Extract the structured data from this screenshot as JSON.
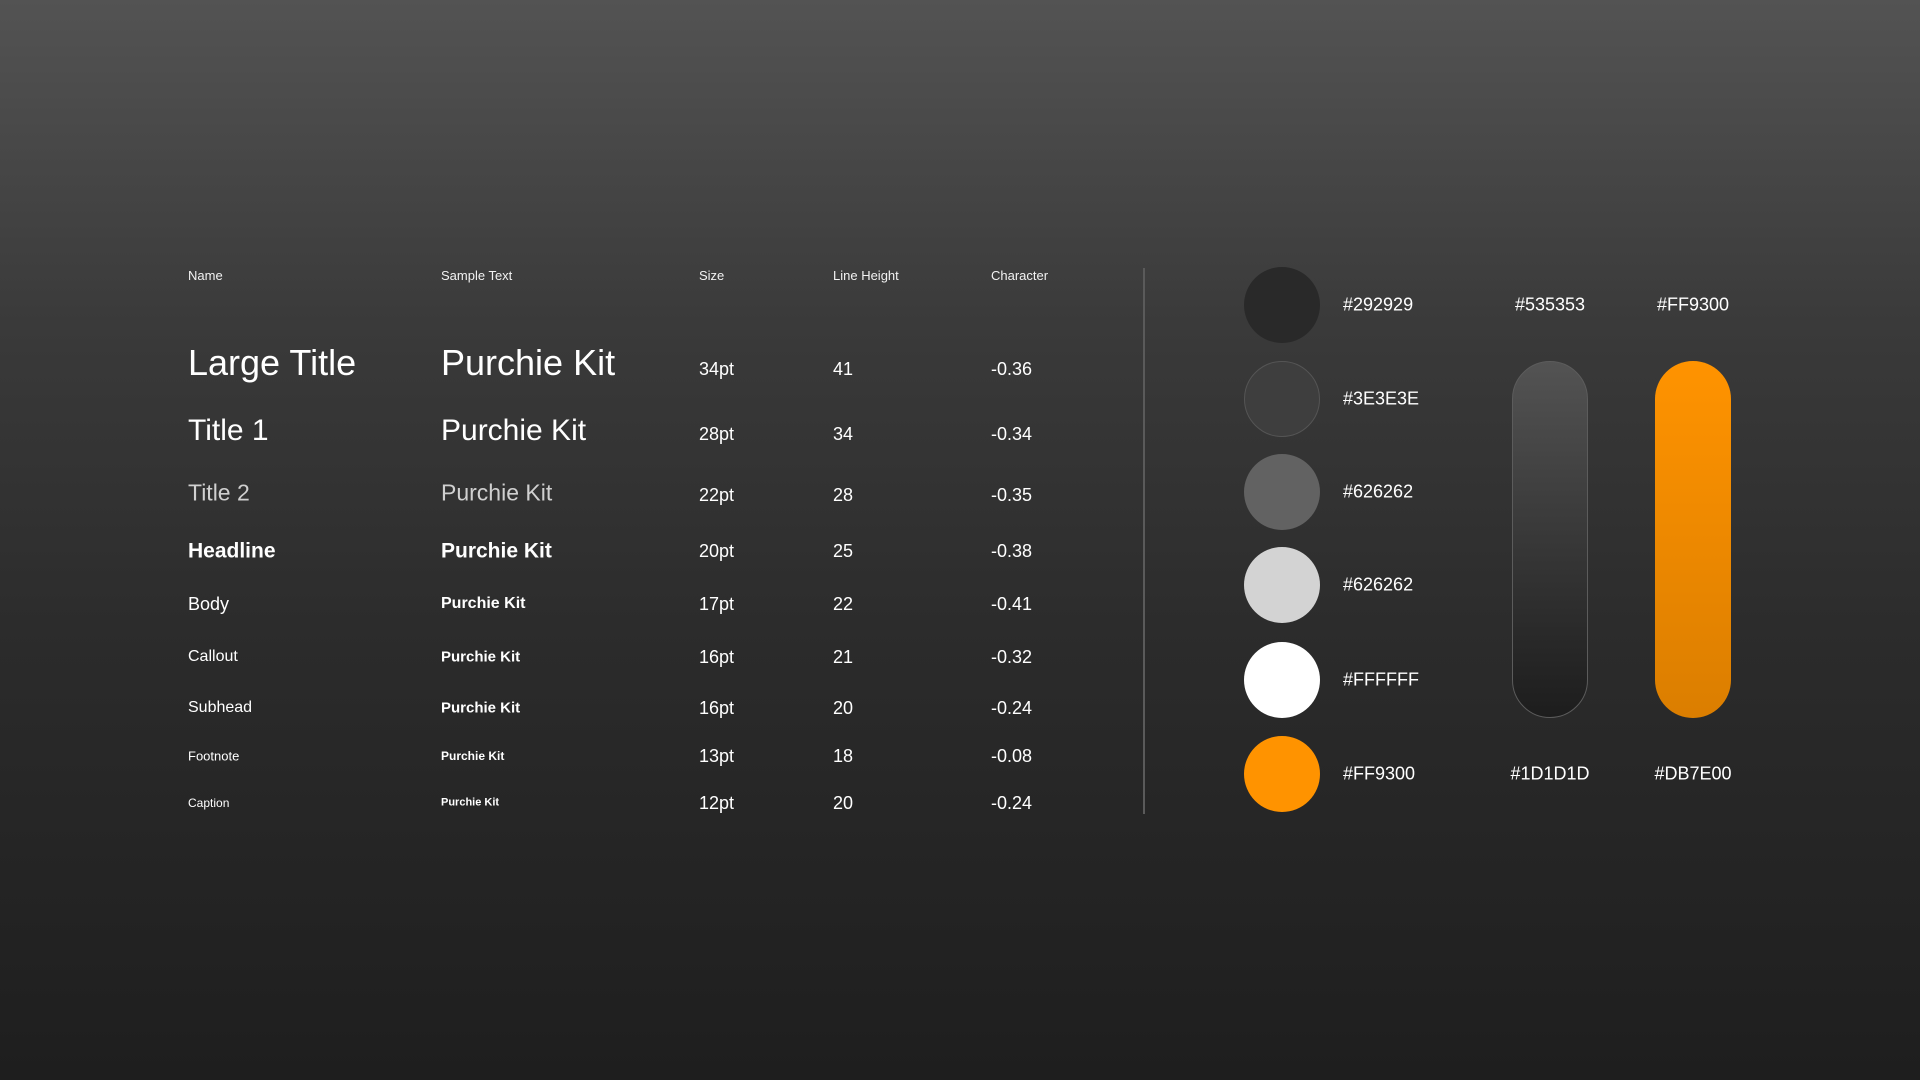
{
  "typography": {
    "headers": {
      "name": "Name",
      "sample": "Sample Text",
      "size": "Size",
      "line_height": "Line Height",
      "character": "Character"
    },
    "rows": [
      {
        "name": "Large Title",
        "sample": "Purchie Kit",
        "size": "34pt",
        "line_height": "41",
        "character": "-0.36"
      },
      {
        "name": "Title 1",
        "sample": "Purchie Kit",
        "size": "28pt",
        "line_height": "34",
        "character": "-0.34"
      },
      {
        "name": "Title 2",
        "sample": "Purchie Kit",
        "size": "22pt",
        "line_height": "28",
        "character": "-0.35"
      },
      {
        "name": "Headline",
        "sample": "Purchie Kit",
        "size": "20pt",
        "line_height": "25",
        "character": "-0.38"
      },
      {
        "name": "Body",
        "sample": "Purchie Kit",
        "size": "17pt",
        "line_height": "22",
        "character": "-0.41"
      },
      {
        "name": "Callout",
        "sample": "Purchie Kit",
        "size": "16pt",
        "line_height": "21",
        "character": "-0.32"
      },
      {
        "name": "Subhead",
        "sample": "Purchie Kit",
        "size": "16pt",
        "line_height": "20",
        "character": "-0.24"
      },
      {
        "name": "Footnote",
        "sample": "Purchie Kit",
        "size": "13pt",
        "line_height": "18",
        "character": "-0.08"
      },
      {
        "name": "Caption",
        "sample": "Purchie Kit",
        "size": "12pt",
        "line_height": "20",
        "character": "-0.24"
      }
    ]
  },
  "palette": {
    "swatches": [
      {
        "label": "#292929",
        "color": "#292929"
      },
      {
        "label": "#3E3E3E",
        "color": "#3E3E3E"
      },
      {
        "label": "#626262",
        "color": "#626262"
      },
      {
        "label": "#626262",
        "color": "#D3D3D3"
      },
      {
        "label": "#FFFFFF",
        "color": "#FFFFFF"
      },
      {
        "label": "#FF9300",
        "color": "#FF9300"
      }
    ],
    "gradients": [
      {
        "top_label": "#535353",
        "bottom_label": "#1D1D1D",
        "top_color": "#535353",
        "bottom_color": "#1D1D1D"
      },
      {
        "top_label": "#FF9300",
        "bottom_label": "#DB7E00",
        "top_color": "#FF9300",
        "bottom_color": "#DB7E00"
      }
    ]
  }
}
